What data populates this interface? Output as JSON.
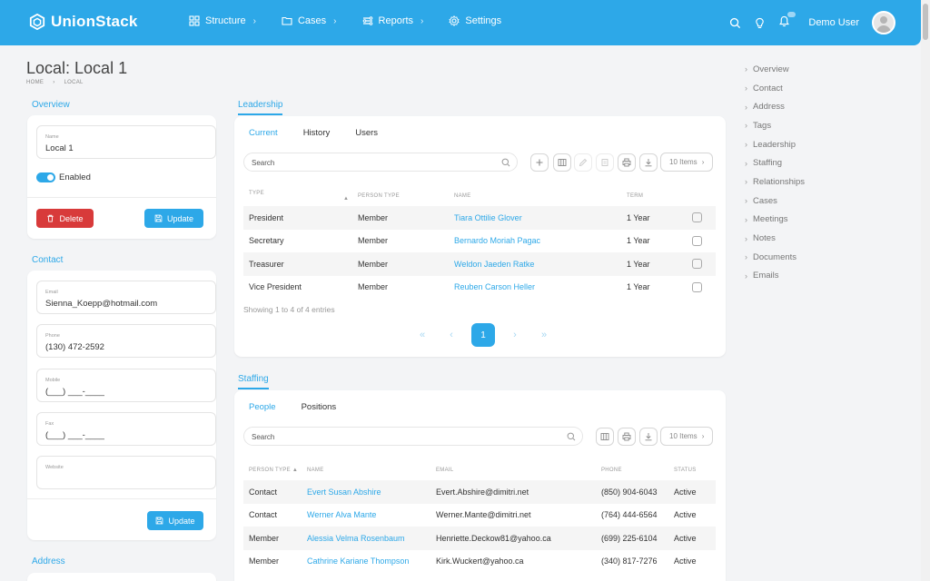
{
  "app": {
    "brand": "UnionStack"
  },
  "nav": [
    {
      "label": "Structure",
      "icon": "grid-icon",
      "chevron": "›"
    },
    {
      "label": "Cases",
      "icon": "folder-icon",
      "chevron": "›"
    },
    {
      "label": "Reports",
      "icon": "chart-icon",
      "chevron": "›"
    },
    {
      "label": "Settings",
      "icon": "gear-icon",
      "chevron": ""
    }
  ],
  "user": {
    "name": "Demo User"
  },
  "page": {
    "title": "Local: Local 1",
    "breadcrumb": [
      "HOME",
      "LOCAL"
    ]
  },
  "overview": {
    "title": "Overview",
    "name_label": "Name",
    "name_value": "Local 1",
    "enabled_label": "Enabled",
    "enabled": true,
    "delete_label": "Delete",
    "update_label": "Update"
  },
  "contact": {
    "title": "Contact",
    "fields": [
      {
        "label": "Email",
        "value": "Sienna_Koepp@hotmail.com"
      },
      {
        "label": "Phone",
        "value": "(130) 472-2592"
      },
      {
        "label": "Mobile",
        "value": "(___) ___-____"
      },
      {
        "label": "Fax",
        "value": "(___) ___-____"
      },
      {
        "label": "Website",
        "value": ""
      }
    ],
    "update_label": "Update"
  },
  "address": {
    "title": "Address"
  },
  "leadership": {
    "title": "Leadership",
    "tabs": [
      "Current",
      "History",
      "Users"
    ],
    "search_placeholder": "Search",
    "items_label": "10 Items",
    "columns": [
      "TYPE",
      "PERSON TYPE",
      "NAME",
      "TERM"
    ],
    "rows": [
      {
        "type": "President",
        "person_type": "Member",
        "name": "Tiara Ottilie Glover",
        "term": "1 Year"
      },
      {
        "type": "Secretary",
        "person_type": "Member",
        "name": "Bernardo Moriah Pagac",
        "term": "1 Year"
      },
      {
        "type": "Treasurer",
        "person_type": "Member",
        "name": "Weldon Jaeden Ratke",
        "term": "1 Year"
      },
      {
        "type": "Vice President",
        "person_type": "Member",
        "name": "Reuben Carson Heller",
        "term": "1 Year"
      }
    ],
    "showing": "Showing 1 to 4 of 4 entries",
    "current_page": "1"
  },
  "staffing": {
    "title": "Staffing",
    "tabs": [
      "People",
      "Positions"
    ],
    "search_placeholder": "Search",
    "items_label": "10 Items",
    "columns": [
      "PERSON TYPE",
      "NAME",
      "EMAIL",
      "PHONE",
      "STATUS"
    ],
    "rows": [
      {
        "person_type": "Contact",
        "name": "Evert Susan Abshire",
        "email": "Evert.Abshire@dimitri.net",
        "phone": "(850) 904-6043",
        "status": "Active"
      },
      {
        "person_type": "Contact",
        "name": "Werner Alva Mante",
        "email": "Werner.Mante@dimitri.net",
        "phone": "(764) 444-6564",
        "status": "Active"
      },
      {
        "person_type": "Member",
        "name": "Alessia Velma Rosenbaum",
        "email": "Henriette.Deckow81@yahoo.ca",
        "phone": "(699) 225-6104",
        "status": "Active"
      },
      {
        "person_type": "Member",
        "name": "Cathrine Kariane Thompson",
        "email": "Kirk.Wuckert@yahoo.ca",
        "phone": "(340) 817-7276",
        "status": "Active"
      }
    ]
  },
  "right_nav": [
    "Overview",
    "Contact",
    "Address",
    "Tags",
    "Leadership",
    "Staffing",
    "Relationships",
    "Cases",
    "Meetings",
    "Notes",
    "Documents",
    "Emails"
  ]
}
